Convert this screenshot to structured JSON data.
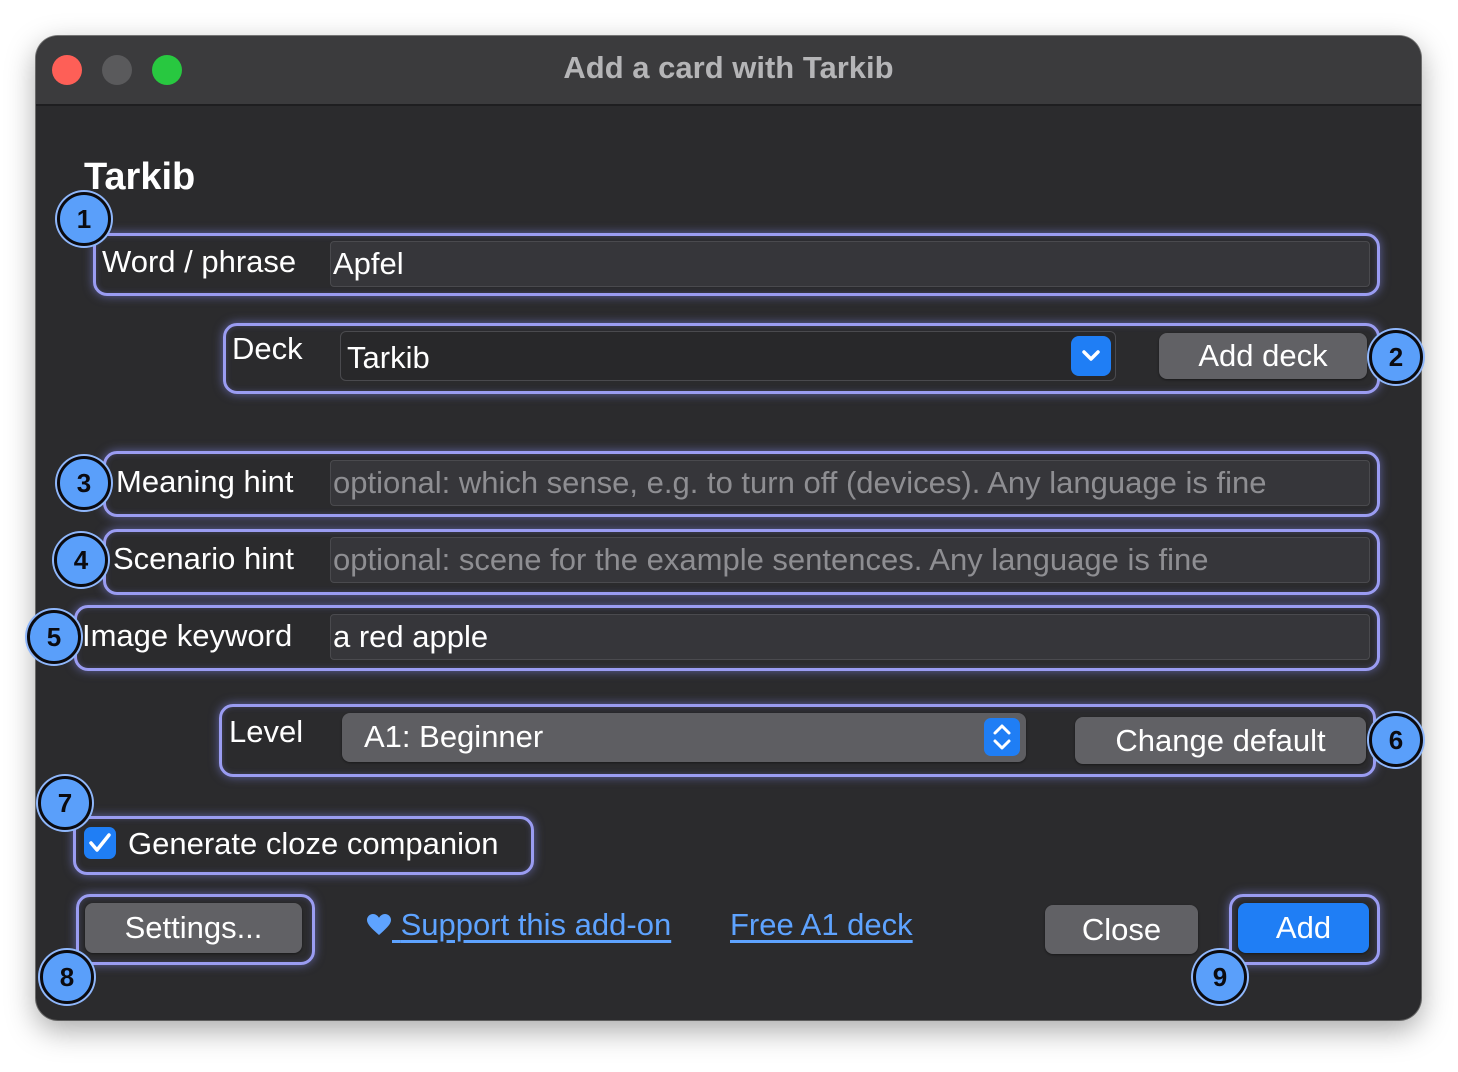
{
  "window": {
    "title": "Add a card with Tarkib"
  },
  "heading": "Tarkib",
  "word": {
    "label": "Word / phrase",
    "value": "Apfel"
  },
  "deck": {
    "label": "Deck",
    "value": "Tarkib",
    "add_button": "Add deck"
  },
  "meaning": {
    "label": "Meaning hint",
    "placeholder": "optional: which sense, e.g. to turn off (devices). Any language is fine"
  },
  "scenario": {
    "label": "Scenario hint",
    "placeholder": "optional: scene for the example sentences. Any language is fine"
  },
  "image": {
    "label": "Image keyword",
    "value": "a red apple"
  },
  "level": {
    "label": "Level",
    "value": "A1: Beginner",
    "change_button": "Change default"
  },
  "cloze": {
    "label": "Generate cloze companion",
    "checked": true
  },
  "footer": {
    "settings": "Settings...",
    "support_link": "Support this add-on",
    "free_deck_link": "Free A1 deck",
    "close": "Close",
    "add": "Add"
  },
  "badges": [
    "1",
    "2",
    "3",
    "4",
    "5",
    "6",
    "7",
    "8",
    "9"
  ],
  "colors": {
    "accent": "#1f7ef5",
    "highlight": "#9a9cf2",
    "badge": "#5a9ffa",
    "link": "#5ea3ff"
  }
}
